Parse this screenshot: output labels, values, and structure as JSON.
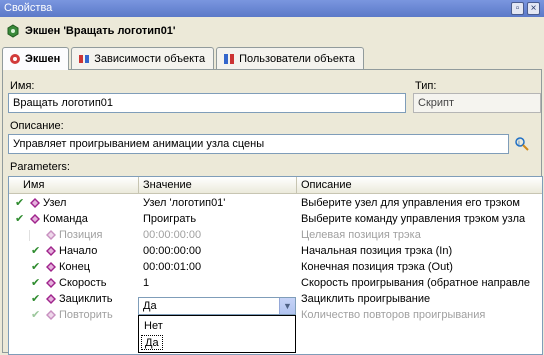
{
  "window": {
    "title": "Свойства"
  },
  "header": {
    "title": "Экшен 'Вращать логотип01'"
  },
  "tabs": [
    {
      "label": "Экшен",
      "active": true
    },
    {
      "label": "Зависимости объекта",
      "active": false
    },
    {
      "label": "Пользователи объекта",
      "active": false
    }
  ],
  "form": {
    "name_label": "Имя:",
    "name_value": "Вращать логотип01",
    "type_label": "Тип:",
    "type_value": "Скрипт",
    "desc_label": "Описание:",
    "desc_value": "Управляет проигрыванием анимации узла сцены",
    "params_label": "Parameters:"
  },
  "grid": {
    "columns": [
      "Имя",
      "Значение",
      "Описание"
    ],
    "rows": [
      {
        "name": "Узел",
        "value": "Узел 'логотип01'",
        "desc": "Выберите узел для управления его трэком",
        "disabled": false,
        "indent": 0
      },
      {
        "name": "Команда",
        "value": "Проиграть",
        "desc": "Выберите команду управления трэком узла",
        "disabled": false,
        "indent": 0
      },
      {
        "name": "Позиция",
        "value": "00:00:00:00",
        "desc": "Целевая позиция трэка",
        "disabled": true,
        "indent": 1
      },
      {
        "name": "Начало",
        "value": "00:00:00:00",
        "desc": "Начальная позиция трэка (In)",
        "disabled": false,
        "indent": 1
      },
      {
        "name": "Конец",
        "value": "00:00:01:00",
        "desc": "Конечная позиция трэка (Out)",
        "disabled": false,
        "indent": 1
      },
      {
        "name": "Скорость",
        "value": "1",
        "desc": "Скорость проигрывания (обратное направле",
        "disabled": false,
        "indent": 1
      },
      {
        "name": "Зациклить",
        "value": "",
        "desc": "Зациклить проигрывание",
        "disabled": false,
        "indent": 1
      },
      {
        "name": "Повторить",
        "value": "",
        "desc": "Количество повторов проигрывания",
        "disabled": true,
        "indent": 1
      }
    ]
  },
  "dropdown": {
    "selected": "Да",
    "options": [
      "Нет",
      "Да"
    ]
  },
  "colors": {
    "check": "#2e8b2e",
    "param_icon": "#a0248c",
    "header_icon": "#3a8a3a"
  }
}
